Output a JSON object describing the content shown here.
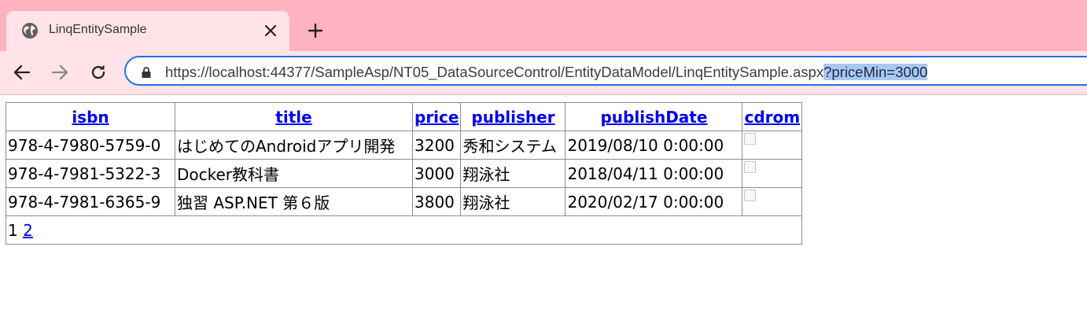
{
  "browser": {
    "tab": {
      "title": "LinqEntitySample",
      "favicon": "globe-icon",
      "close_icon": "close-icon"
    },
    "new_tab_icon": "plus-icon",
    "nav": {
      "back_icon": "back-arrow-icon",
      "forward_icon": "forward-arrow-icon",
      "reload_icon": "reload-icon"
    },
    "address": {
      "lock_icon": "lock-icon",
      "url_main": "https://localhost:44377/SampleAsp/NT05_DataSourceControl/EntityDataModel/LinqEntitySample.aspx",
      "url_selected": "?priceMin=3000"
    },
    "colors": {
      "tabstrip": "#ffb3c1",
      "toolbar": "#ffe3e9",
      "focus": "#1a73e8",
      "selection": "#a9c8f0"
    }
  },
  "grid": {
    "headers": [
      "isbn",
      "title",
      "price",
      "publisher",
      "publishDate",
      "cdrom"
    ],
    "rows": [
      {
        "isbn": "978-4-7980-5759-0",
        "title": "はじめてのAndroidアプリ開発",
        "price": "3200",
        "publisher": "秀和システム",
        "publishDate": "2019/08/10 0:00:00",
        "cdrom": false
      },
      {
        "isbn": "978-4-7981-5322-3",
        "title": "Docker教科書",
        "price": "3000",
        "publisher": "翔泳社",
        "publishDate": "2018/04/11 0:00:00",
        "cdrom": false
      },
      {
        "isbn": "978-4-7981-6365-9",
        "title": "独習 ASP.NET 第６版",
        "price": "3800",
        "publisher": "翔泳社",
        "publishDate": "2020/02/17 0:00:00",
        "cdrom": false
      }
    ],
    "pager": {
      "current": "1",
      "pages": [
        "2"
      ]
    },
    "link_color": "#0000ee"
  }
}
